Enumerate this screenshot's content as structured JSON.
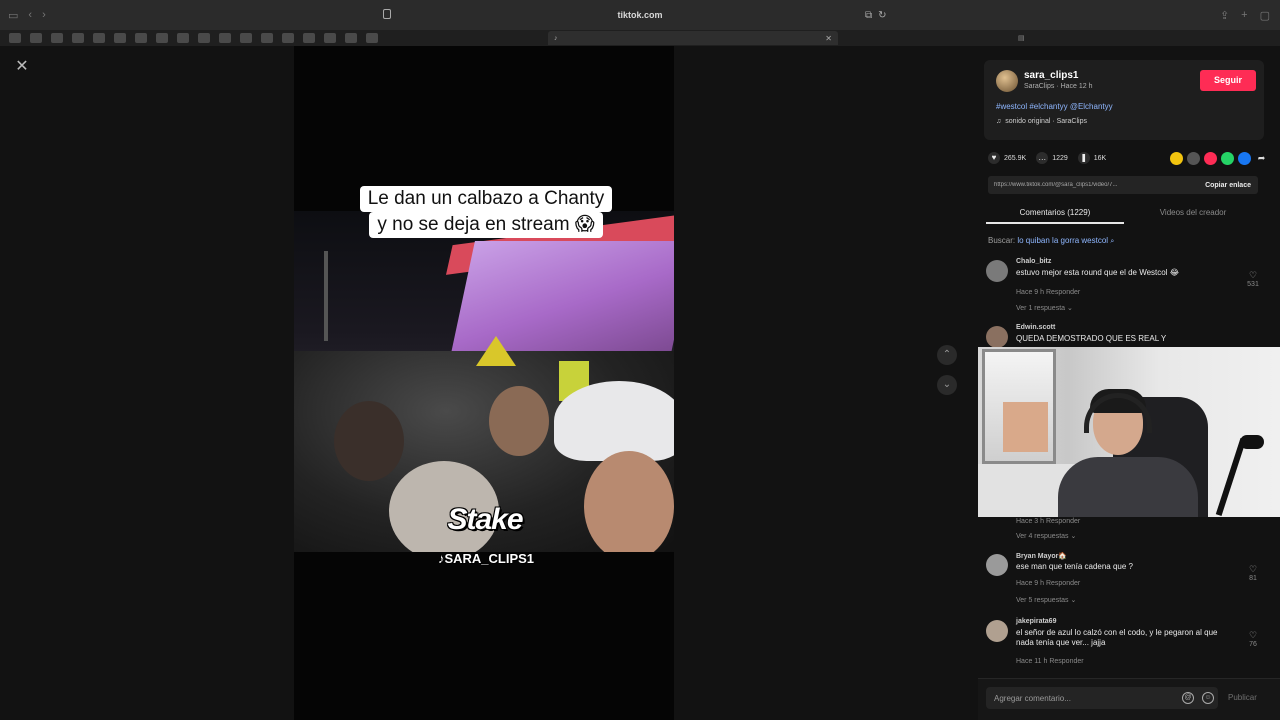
{
  "browser": {
    "address": "tiktok.com",
    "active_tab": "",
    "other_tab": ""
  },
  "video": {
    "caption_line1": "Le dan un calbazo a Chanty",
    "caption_line2": "y no se deja en stream 😱",
    "logo_text": "Stake",
    "watermark": "♪SARA_CLIPS1"
  },
  "creator": {
    "username": "sara_clips1",
    "subtitle": "SaraClips · Hace 12 h",
    "follow_label": "Seguir",
    "hashtags": "#westcol #elchantyy @Elchantyy",
    "sound": "sonido original · SaraClips"
  },
  "actions": {
    "likes": "265.9K",
    "comments": "1229",
    "saves": "16K"
  },
  "link": {
    "url": "https://www.tiktok.com/@sara_clips1/video/7...",
    "copy_label": "Copiar enlace"
  },
  "tabs": [
    {
      "label": "Comentarios (1229)"
    },
    {
      "label": "Videos del creador"
    }
  ],
  "search_suggestion": {
    "prefix": "Buscar:",
    "query": "lo quiban la gorra westcol"
  },
  "comments": [
    {
      "user": "Chalo_bitz",
      "text": "estuvo mejor esta round que el de Westcol 😂",
      "meta": "Hace 9 h   Responder",
      "replies": "Ver 1 respuesta ⌄",
      "likes": "531"
    },
    {
      "user": "Edwin.scott",
      "text": "QUEDA DEMOSTRADO QUE ES REAL Y",
      "meta": "",
      "replies": "",
      "likes": ""
    },
    {
      "user": "",
      "text": "",
      "meta": "Hace 3 h   Responder",
      "replies": "Ver 4 respuestas ⌄",
      "likes": ""
    },
    {
      "user": "Bryan Mayor🏠",
      "text": "ese man que tenía cadena que ?",
      "meta": "Hace 9 h   Responder",
      "replies": "Ver 5 respuestas ⌄",
      "likes": "81"
    },
    {
      "user": "jakepirata69",
      "text": "el señor de azul lo calzó con el codo, y le pegaron al que nada tenía que ver... jajja",
      "meta": "Hace 11 h   Responder",
      "replies": "",
      "likes": "76"
    }
  ],
  "comment_input": {
    "placeholder": "Agregar comentario...",
    "post_label": "Publicar"
  }
}
